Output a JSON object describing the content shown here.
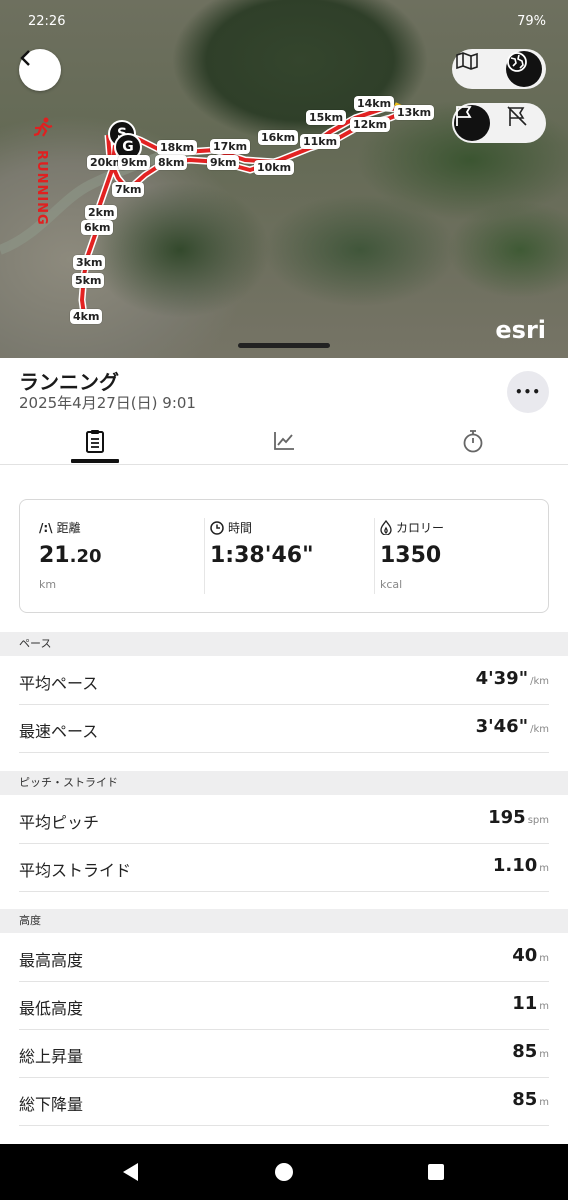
{
  "status_bar": {
    "time": "22:26",
    "battery": "79%"
  },
  "map": {
    "activity_label": "RUNNING",
    "watermark": "esri",
    "start_marker": "S",
    "goal_marker": "G",
    "km_markers": [
      "2km",
      "3km",
      "4km",
      "5km",
      "6km",
      "7km",
      "8km",
      "9km",
      "10km",
      "11km",
      "12km",
      "13km",
      "14km",
      "15km",
      "16km",
      "17km",
      "18km",
      "20km"
    ],
    "route_color": "#e32222",
    "view_toggle": {
      "map_icon": "map-icon",
      "satellite_icon": "globe-icon",
      "selected": "satellite"
    },
    "flag_toggle": {
      "on_icon": "flag-icon",
      "off_icon": "flag-off-icon",
      "selected": "on"
    }
  },
  "header": {
    "title": "ランニング",
    "datetime": "2025年4月27日(日) 9:01",
    "more_label": "•••"
  },
  "tabs": [
    {
      "name": "summary",
      "icon": "clipboard-icon",
      "selected": true
    },
    {
      "name": "graph",
      "icon": "chart-icon",
      "selected": false
    },
    {
      "name": "laps",
      "icon": "stopwatch-icon",
      "selected": false
    }
  ],
  "summary": {
    "distance": {
      "icon_text": "/:\\",
      "label": "距離",
      "value_int": "21",
      "value_dec": ".20",
      "unit": "km"
    },
    "time": {
      "label": "時間",
      "value": "1:38'46\""
    },
    "calories": {
      "label": "カロリー",
      "value": "1350",
      "unit": "kcal"
    }
  },
  "sections": [
    {
      "header": "ペース",
      "rows": [
        {
          "label": "平均ペース",
          "value": "4'39\"",
          "unit": "/km"
        },
        {
          "label": "最速ペース",
          "value": "3'46\"",
          "unit": "/km"
        }
      ]
    },
    {
      "header": "ピッチ・ストライド",
      "rows": [
        {
          "label": "平均ピッチ",
          "value": "195",
          "unit": "spm"
        },
        {
          "label": "平均ストライド",
          "value": "1.10",
          "unit": "m"
        }
      ]
    },
    {
      "header": "高度",
      "rows": [
        {
          "label": "最高高度",
          "value": "40",
          "unit": "m"
        },
        {
          "label": "最低高度",
          "value": "11",
          "unit": "m"
        },
        {
          "label": "総上昇量",
          "value": "85",
          "unit": "m"
        },
        {
          "label": "総下降量",
          "value": "85",
          "unit": "m"
        }
      ]
    }
  ],
  "nav_bar": {
    "back": "back-triangle-icon",
    "home": "home-circle-icon",
    "recents": "recents-square-icon"
  }
}
